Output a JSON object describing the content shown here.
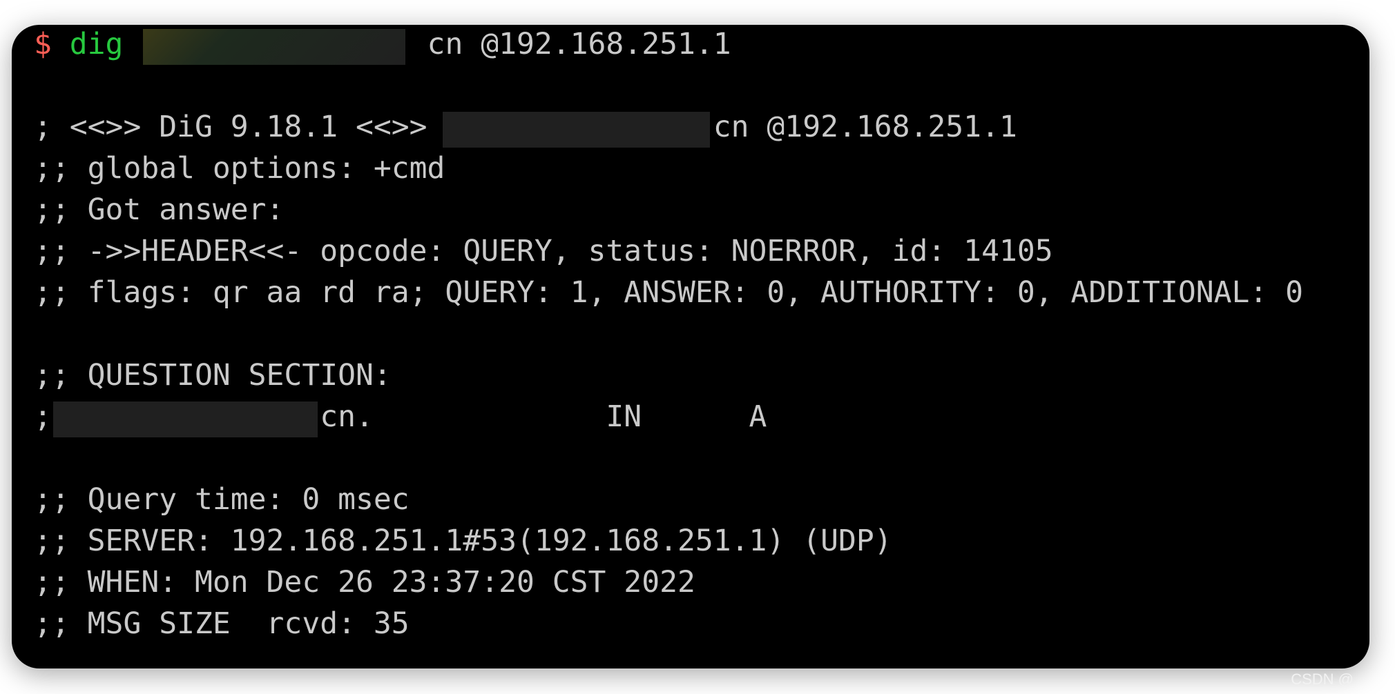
{
  "terminal": {
    "prompt_symbol": "$",
    "command": "dig",
    "command_rest": " (               cn @192.168.251.1",
    "lines": [
      "",
      "; <<>> DiG 9.18.1 <<>>                cn @192.168.251.1",
      ";; global options: +cmd",
      ";; Got answer:",
      ";; ->>HEADER<<- opcode: QUERY, status: NOERROR, id: 14105",
      ";; flags: qr aa rd ra; QUERY: 1, ANSWER: 0, AUTHORITY: 0, ADDITIONAL: 0",
      "",
      ";; QUESTION SECTION:",
      ";(              cn.             IN      A",
      "",
      ";; Query time: 0 msec",
      ";; SERVER: 192.168.251.1#53(192.168.251.1) (UDP)",
      ";; WHEN: Mon Dec 26 23:37:20 CST 2022",
      ";; MSG SIZE  rcvd: 35"
    ]
  },
  "colors": {
    "prompt": "#ff5f56",
    "command": "#27c93f",
    "text": "#c9c9c9",
    "background": "#000000"
  },
  "watermark": "CSDN @"
}
